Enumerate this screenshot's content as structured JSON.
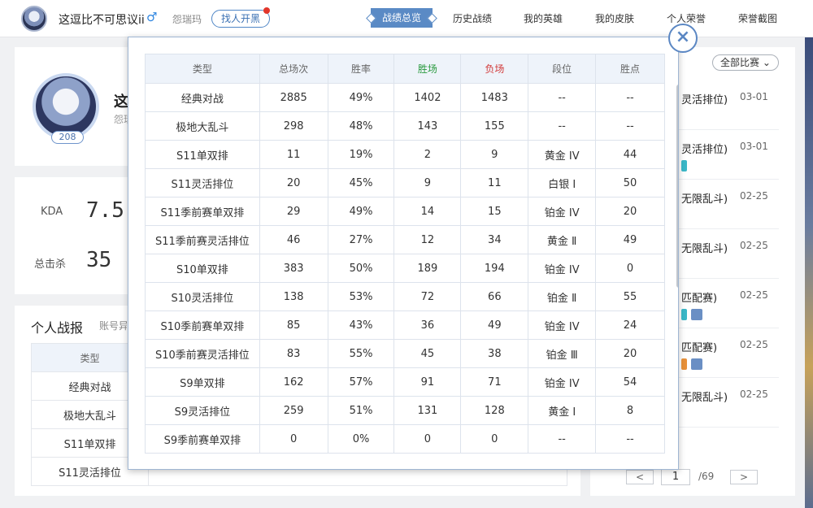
{
  "header": {
    "player_name": "这逗比不可思议ii",
    "gender_symbol": "♂",
    "server": "怨瑞玛",
    "find_button": "找人开黑",
    "tabs": [
      "战绩总览",
      "历史战绩",
      "我的英雄",
      "我的皮肤",
      "个人荣誉",
      "荣誉截图"
    ],
    "active_tab": "战绩总览"
  },
  "profile": {
    "name_visible": "这",
    "server_visible": "怨瑞",
    "level": "208"
  },
  "stats": {
    "kda_label": "KDA",
    "kda_value": "7.5",
    "kills_label": "总击杀",
    "kills_value": "35"
  },
  "record": {
    "title": "个人战报",
    "subtitle": "账号异",
    "header": "类型",
    "rows": [
      "经典对战",
      "极地大乱斗",
      "S11单双排",
      "S11灵活排位"
    ]
  },
  "history": {
    "filter": "全部比赛",
    "rows": [
      {
        "mode": "灵活排位)",
        "date": "03-01"
      },
      {
        "mode": "灵活排位)",
        "date": "03-01"
      },
      {
        "mode": "无限乱斗)",
        "date": "02-25"
      },
      {
        "mode": "无限乱斗)",
        "date": "02-25"
      },
      {
        "mode": "匹配赛)",
        "date": "02-25"
      },
      {
        "mode": "匹配赛)",
        "date": "02-25"
      },
      {
        "mode": "无限乱斗)",
        "date": "02-25"
      }
    ],
    "page": "1",
    "total": "/69",
    "prev": "<",
    "next": ">"
  },
  "modal": {
    "close": "×",
    "columns": [
      "类型",
      "总场次",
      "胜率",
      "胜场",
      "负场",
      "段位",
      "胜点"
    ],
    "rows": [
      [
        "经典对战",
        "2885",
        "49%",
        "1402",
        "1483",
        "--",
        "--"
      ],
      [
        "极地大乱斗",
        "298",
        "48%",
        "143",
        "155",
        "--",
        "--"
      ],
      [
        "S11单双排",
        "11",
        "19%",
        "2",
        "9",
        "黄金 IV",
        "44"
      ],
      [
        "S11灵活排位",
        "20",
        "45%",
        "9",
        "11",
        "白银 Ⅰ",
        "50"
      ],
      [
        "S11季前赛单双排",
        "29",
        "49%",
        "14",
        "15",
        "铂金 IV",
        "20"
      ],
      [
        "S11季前赛灵活排位",
        "46",
        "27%",
        "12",
        "34",
        "黄金 Ⅱ",
        "49"
      ],
      [
        "S10单双排",
        "383",
        "50%",
        "189",
        "194",
        "铂金 IV",
        "0"
      ],
      [
        "S10灵活排位",
        "138",
        "53%",
        "72",
        "66",
        "铂金 Ⅱ",
        "55"
      ],
      [
        "S10季前赛单双排",
        "85",
        "43%",
        "36",
        "49",
        "铂金 IV",
        "24"
      ],
      [
        "S10季前赛灵活排位",
        "83",
        "55%",
        "45",
        "38",
        "铂金 Ⅲ",
        "20"
      ],
      [
        "S9单双排",
        "162",
        "57%",
        "91",
        "71",
        "铂金 IV",
        "54"
      ],
      [
        "S9灵活排位",
        "259",
        "51%",
        "131",
        "128",
        "黄金 Ⅰ",
        "8"
      ],
      [
        "S9季前赛单双排",
        "0",
        "0%",
        "0",
        "0",
        "--",
        "--"
      ]
    ]
  }
}
